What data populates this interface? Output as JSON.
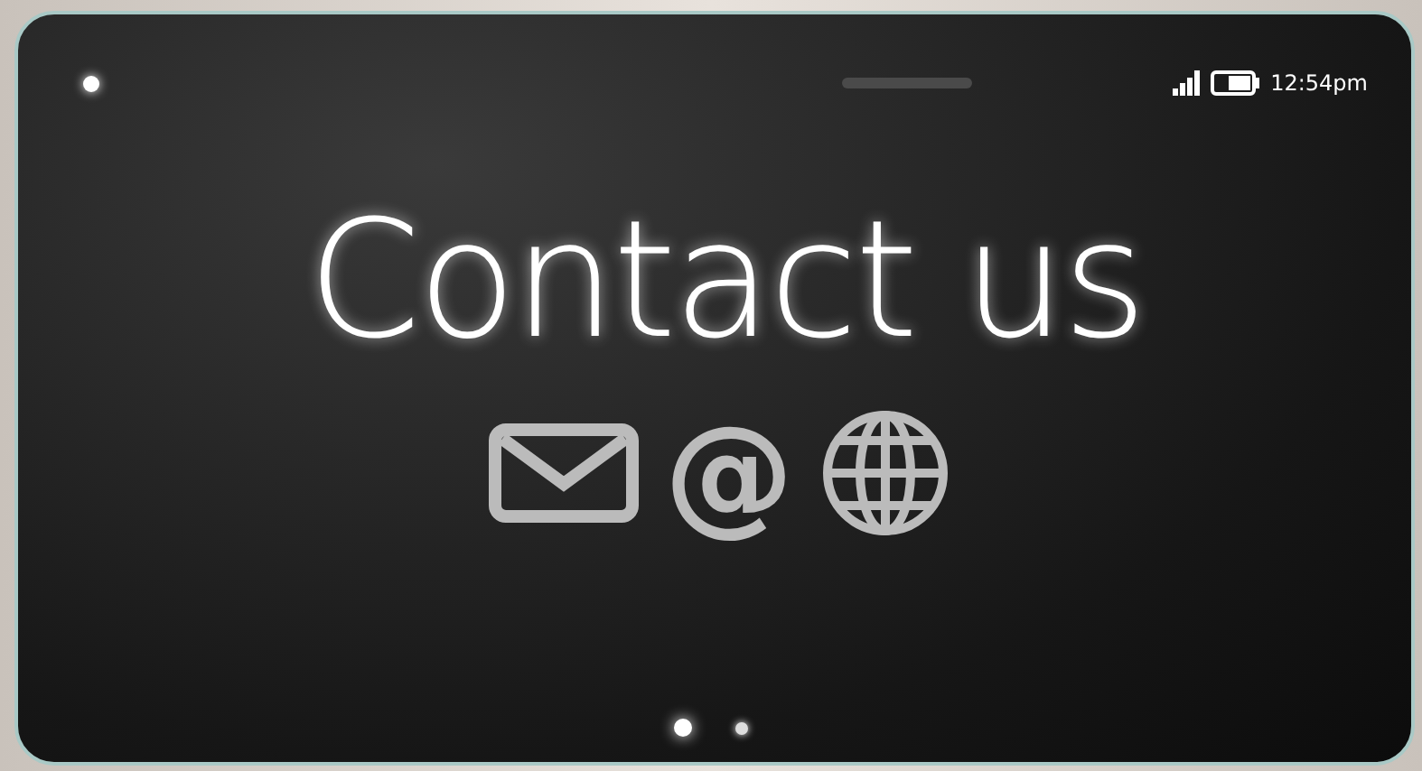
{
  "status_bar": {
    "time": "12:54pm"
  },
  "title": "Contact us",
  "contact_icons": [
    {
      "kind": "mail"
    },
    {
      "kind": "glyph",
      "glyph": "@"
    },
    {
      "kind": "globe"
    }
  ],
  "page_dots": [
    {
      "selected": true
    },
    {
      "selected": false
    }
  ]
}
